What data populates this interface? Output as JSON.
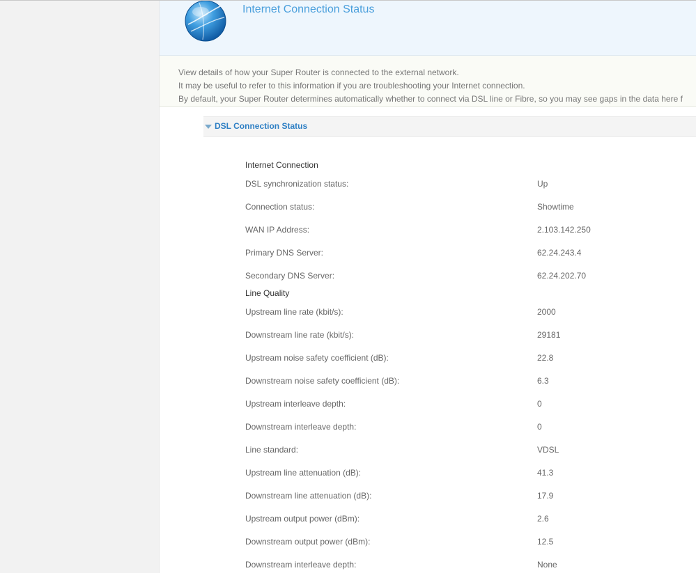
{
  "header": {
    "title": "Internet Connection Status",
    "icon": "globe-icon"
  },
  "intro": {
    "line1": "View details of how your Super Router is connected to the external network.",
    "line2": "It may be useful to refer to this information if you are troubleshooting your Internet connection.",
    "line3": "By default, your Super Router determines automatically whether to connect via DSL line or Fibre, so you may see gaps in the data here f"
  },
  "section": {
    "title": "DSL Connection Status",
    "expanded": true
  },
  "internet_connection": {
    "heading": "Internet Connection",
    "rows": [
      {
        "label": "DSL synchronization status:",
        "value": "Up"
      },
      {
        "label": "Connection status:",
        "value": "Showtime"
      },
      {
        "label": "WAN IP Address:",
        "value": "2.103.142.250"
      },
      {
        "label": "Primary DNS Server:",
        "value": "62.24.243.4"
      },
      {
        "label": "Secondary DNS Server:",
        "value": "62.24.202.70"
      }
    ]
  },
  "line_quality": {
    "heading": "Line Quality",
    "rows": [
      {
        "label": "Upstream line rate (kbit/s):",
        "value": "2000"
      },
      {
        "label": "Downstream line rate (kbit/s):",
        "value": "29181"
      },
      {
        "label": "Upstream noise safety coefficient (dB):",
        "value": "22.8"
      },
      {
        "label": "Downstream noise safety coefficient (dB):",
        "value": "6.3"
      },
      {
        "label": "Upstream interleave depth:",
        "value": "0"
      },
      {
        "label": "Downstream interleave depth:",
        "value": "0"
      },
      {
        "label": "Line standard:",
        "value": "VDSL"
      },
      {
        "label": "Upstream line attenuation (dB):",
        "value": "41.3"
      },
      {
        "label": "Downstream line attenuation (dB):",
        "value": "17.9"
      },
      {
        "label": "Upstream output power (dBm):",
        "value": "2.6"
      },
      {
        "label": "Downstream output power (dBm):",
        "value": "12.5"
      },
      {
        "label": "Downstream interleave depth:",
        "value": "None"
      }
    ]
  },
  "colors": {
    "title_blue": "#4a9fdc",
    "section_blue": "#2e7fc4",
    "header_bg": "#eef6fd",
    "sidebar_bg": "#f2f2f2"
  }
}
